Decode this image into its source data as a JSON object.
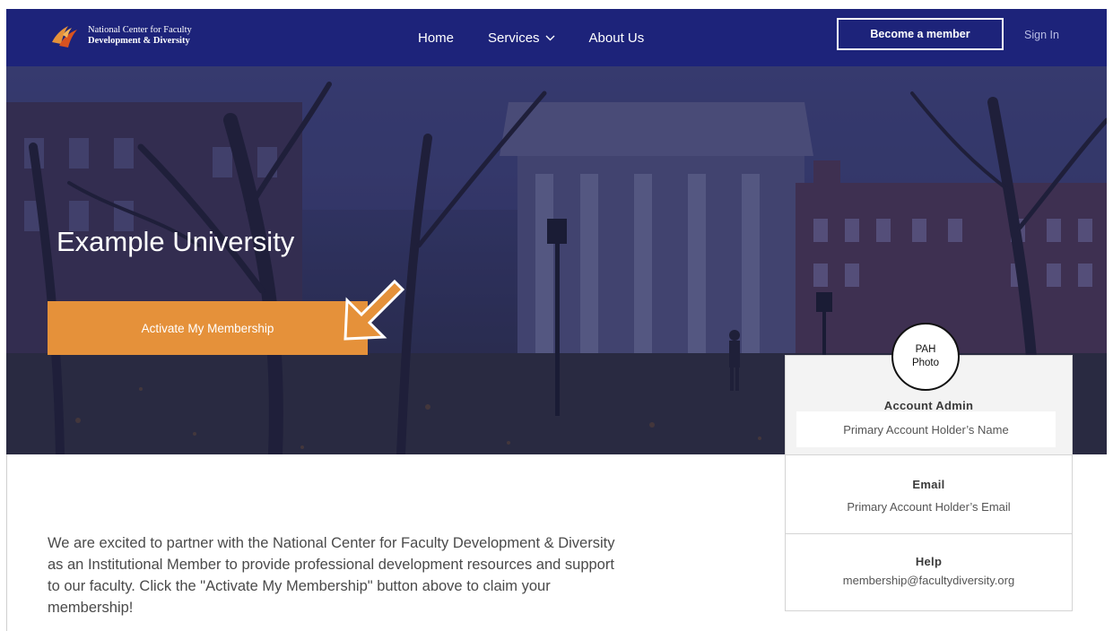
{
  "nav": {
    "logo_line1": "National Center for Faculty",
    "logo_line2": "Development & Diversity",
    "links": [
      {
        "label": "Home"
      },
      {
        "label": "Services"
      },
      {
        "label": "About Us"
      }
    ],
    "become_member": "Become a member",
    "sign_in": "Sign In"
  },
  "hero": {
    "title": "Example University",
    "activate_label": "Activate My Membership"
  },
  "card": {
    "photo_line1": "PAH",
    "photo_line2": "Photo",
    "admin_label": "Account Admin",
    "admin_value": "Primary Account Holder’s Name",
    "email_label": "Email",
    "email_value": "Primary Account Holder’s Email",
    "help_label": "Help",
    "help_value": "membership@facultydiversity.org"
  },
  "intro_text": "We are excited to partner with the National Center for Faculty Development & Diversity as an Institutional Member to provide professional development resources and support to our faculty. Click the \"Activate My Membership\" button above to claim your membership!",
  "colors": {
    "nav_bg": "#1d237a",
    "accent_orange": "#e5913a"
  },
  "icons": {
    "logo": "ncfdd-flame-logo",
    "services_chevron": "chevron-down-icon",
    "pointer": "arrow-down-left-icon"
  }
}
